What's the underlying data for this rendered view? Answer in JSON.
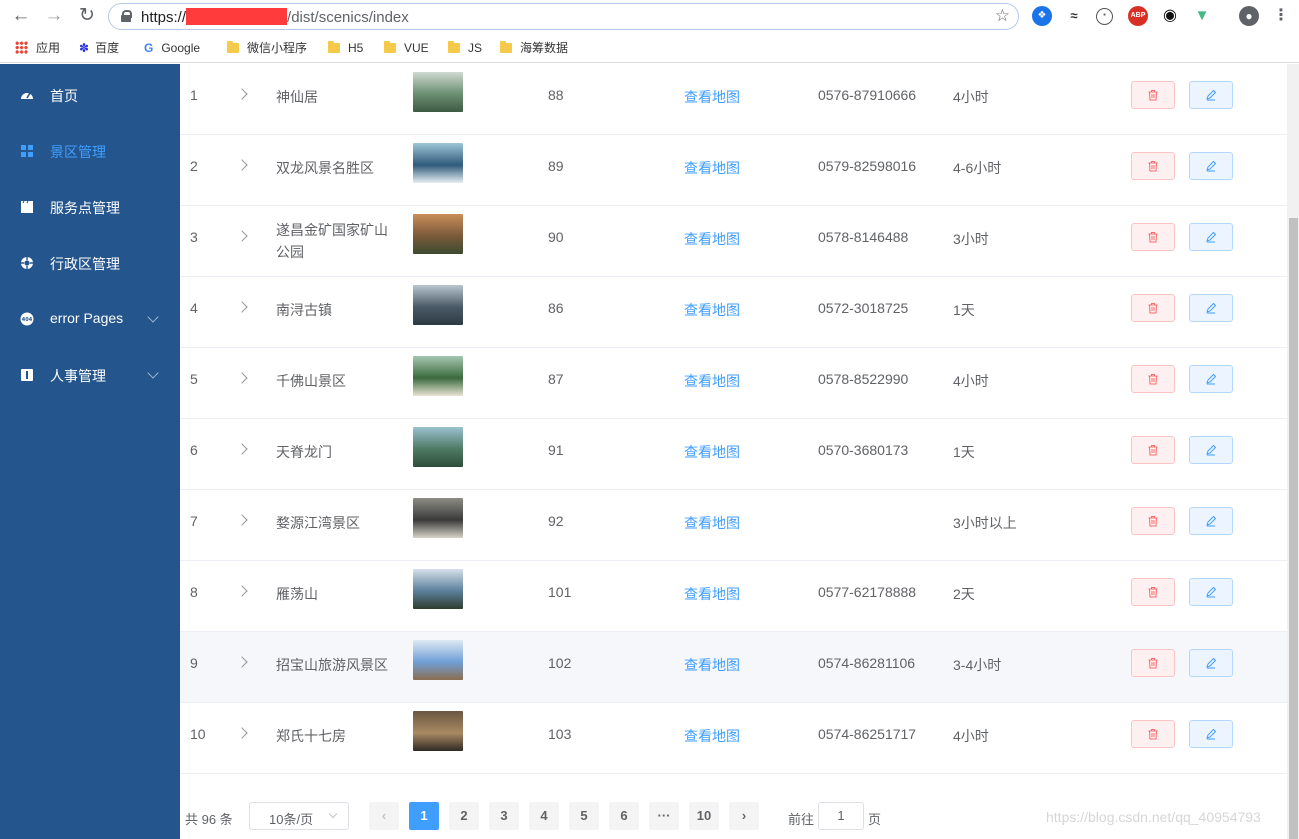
{
  "browser": {
    "url_scheme": "https://",
    "url_path": "/dist/scenics/index",
    "bookmarks": [
      "应用",
      "百度",
      "Google",
      "微信小程序",
      "H5",
      "VUE",
      "JS",
      "海筹数据"
    ]
  },
  "sidebar": {
    "items": [
      {
        "label": "首页",
        "icon": "dashboard-icon",
        "active": false
      },
      {
        "label": "景区管理",
        "icon": "grid-icon",
        "active": true
      },
      {
        "label": "服务点管理",
        "icon": "clapperboard-icon",
        "active": false
      },
      {
        "label": "行政区管理",
        "icon": "lifebuoy-icon",
        "active": false
      },
      {
        "label": "error Pages",
        "icon": "404-icon",
        "active": false,
        "expandable": true
      },
      {
        "label": "人事管理",
        "icon": "info-icon",
        "active": false,
        "expandable": true
      }
    ]
  },
  "table": {
    "rows": [
      {
        "index": "1",
        "name": "神仙居",
        "score": "88",
        "map_link": "查看地图",
        "phone": "0576-87910666",
        "duration": "4小时"
      },
      {
        "index": "2",
        "name": "双龙风景名胜区",
        "score": "89",
        "map_link": "查看地图",
        "phone": "0579-82598016",
        "duration": "4-6小时"
      },
      {
        "index": "3",
        "name": "遂昌金矿国家矿山公园",
        "score": "90",
        "map_link": "查看地图",
        "phone": "0578-8146488",
        "duration": "3小时"
      },
      {
        "index": "4",
        "name": "南浔古镇",
        "score": "86",
        "map_link": "查看地图",
        "phone": "0572-3018725",
        "duration": "1天"
      },
      {
        "index": "5",
        "name": "千佛山景区",
        "score": "87",
        "map_link": "查看地图",
        "phone": "0578-8522990",
        "duration": "4小时"
      },
      {
        "index": "6",
        "name": "天脊龙门",
        "score": "91",
        "map_link": "查看地图",
        "phone": "0570-3680173",
        "duration": "1天"
      },
      {
        "index": "7",
        "name": "婺源江湾景区",
        "score": "92",
        "map_link": "查看地图",
        "phone": "",
        "duration": "3小时以上"
      },
      {
        "index": "8",
        "name": "雁荡山",
        "score": "101",
        "map_link": "查看地图",
        "phone": "0577-62178888",
        "duration": "2天"
      },
      {
        "index": "9",
        "name": "招宝山旅游风景区",
        "score": "102",
        "map_link": "查看地图",
        "phone": "0574-86281106",
        "duration": "3-4小时"
      },
      {
        "index": "10",
        "name": "郑氏十七房",
        "score": "103",
        "map_link": "查看地图",
        "phone": "0574-86251717",
        "duration": "4小时"
      }
    ]
  },
  "pagination": {
    "total_text": "共 96 条",
    "page_size": "10条/页",
    "pages": [
      "1",
      "2",
      "3",
      "4",
      "5",
      "6",
      "···",
      "10"
    ],
    "current_page": "1",
    "goto_label": "前往",
    "goto_value": "1",
    "page_suffix": "页"
  },
  "watermark": "https://blog.csdn.net/qq_40954793",
  "colors": {
    "sidebar_bg": "#24558d",
    "accent": "#409eff",
    "danger_bg": "#fef0f0",
    "redaction": "#ff3b3b"
  }
}
